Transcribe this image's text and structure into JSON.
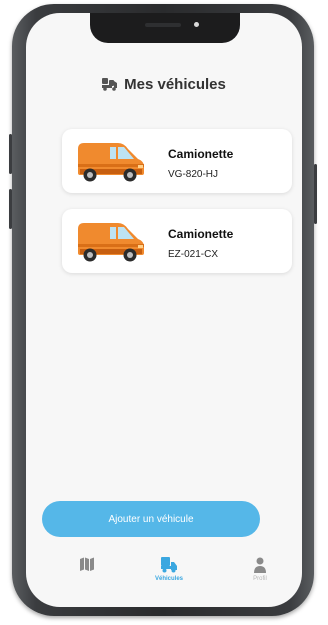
{
  "header": {
    "title": "Mes véhicules",
    "icon": "truck-loading-icon"
  },
  "vehicles": [
    {
      "name": "Camionette",
      "plate": "VG-820-HJ",
      "icon": "van-icon"
    },
    {
      "name": "Camionette",
      "plate": "EZ-021-CX",
      "icon": "van-icon"
    }
  ],
  "actions": {
    "add_vehicle_label": "Ajouter un véhicule"
  },
  "nav": {
    "map": {
      "label": "",
      "icon": "map-icon"
    },
    "vehicles": {
      "label": "Véhicules",
      "icon": "truck-icon",
      "active": true
    },
    "profile": {
      "label": "Profil",
      "icon": "user-icon"
    }
  },
  "colors": {
    "accent": "#55b7e8",
    "nav_active": "#3aa7e0",
    "van_body": "#f08a2e",
    "screen_bg": "#f7f7f7"
  }
}
